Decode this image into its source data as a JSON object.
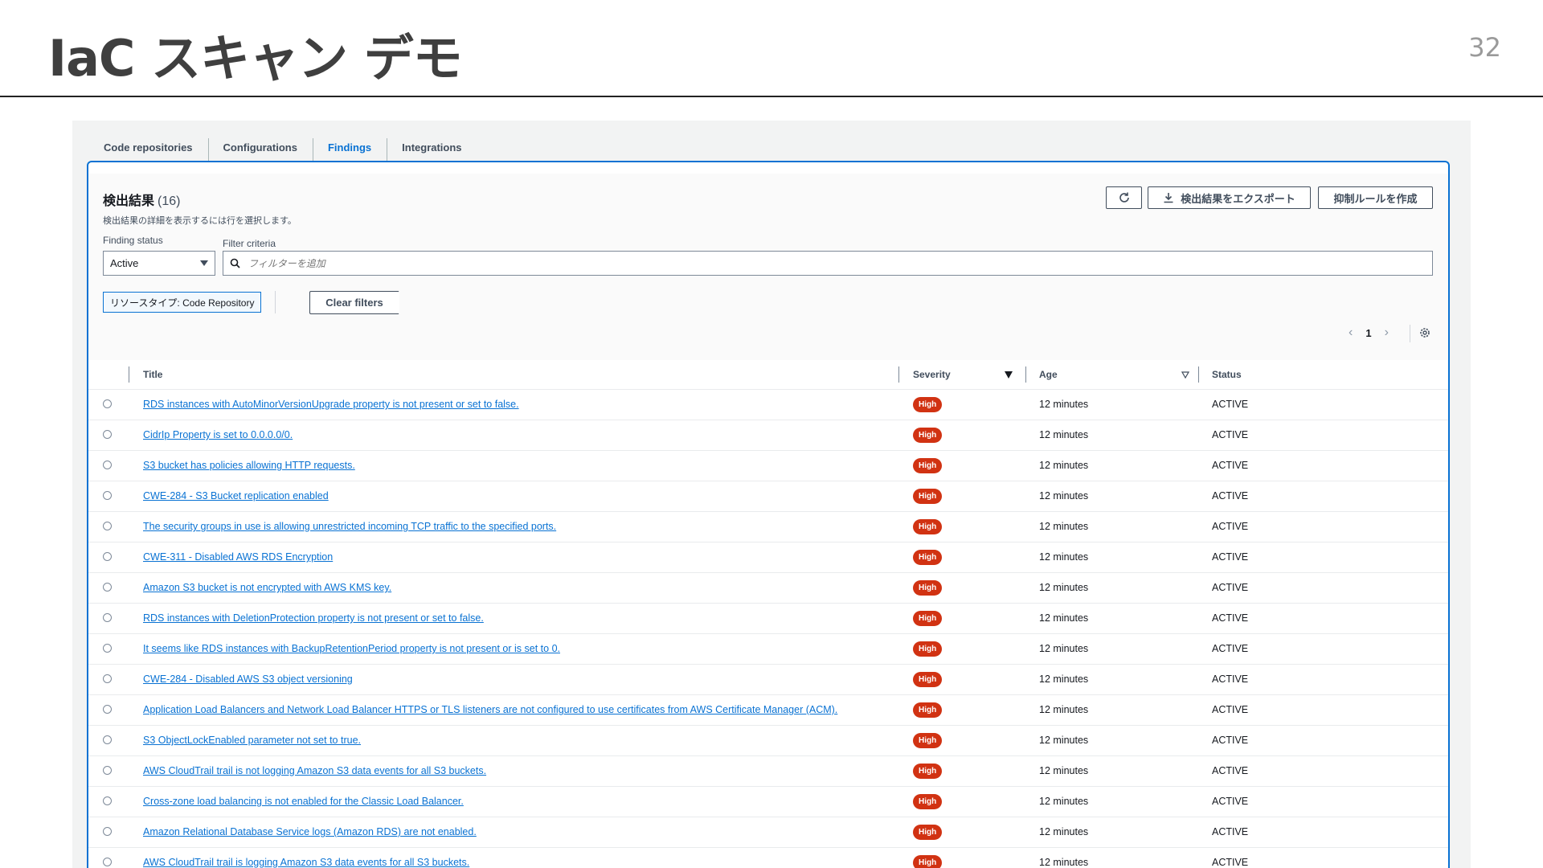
{
  "slide": {
    "title": "IaC スキャン デモ",
    "page_number": "32"
  },
  "tabs": [
    {
      "label": "Code repositories",
      "active": false
    },
    {
      "label": "Configurations",
      "active": false
    },
    {
      "label": "Findings",
      "active": true
    },
    {
      "label": "Integrations",
      "active": false
    }
  ],
  "panel": {
    "title": "検出結果",
    "count": "(16)",
    "description": "検出結果の詳細を表示するには行を選択します。",
    "refresh_icon": "refresh-icon",
    "export_label": "検出結果をエクスポート",
    "export_icon": "download-icon",
    "create_rule_label": "抑制ルールを作成"
  },
  "filters": {
    "status_label": "Finding status",
    "status_value": "Active",
    "criteria_label": "Filter criteria",
    "criteria_placeholder": "フィルターを追加",
    "resource_token": "リソースタイプ: Code Repository",
    "clear_label": "Clear filters"
  },
  "pagination": {
    "current_page": "1",
    "prev_icon": "chevron-left-icon",
    "next_icon": "chevron-right-icon",
    "settings_icon": "gear-icon"
  },
  "table": {
    "columns": {
      "title": "Title",
      "severity": "Severity",
      "age": "Age",
      "status": "Status"
    },
    "rows": [
      {
        "title": "RDS instances with AutoMinorVersionUpgrade property is not present or set to false.",
        "severity": "High",
        "age": "12 minutes",
        "status": "ACTIVE"
      },
      {
        "title": "CidrIp Property is set to 0.0.0.0/0.",
        "severity": "High",
        "age": "12 minutes",
        "status": "ACTIVE"
      },
      {
        "title": "S3 bucket has policies allowing HTTP requests.",
        "severity": "High",
        "age": "12 minutes",
        "status": "ACTIVE"
      },
      {
        "title": "CWE-284 - S3 Bucket replication enabled",
        "severity": "High",
        "age": "12 minutes",
        "status": "ACTIVE"
      },
      {
        "title": "The security groups in use is allowing unrestricted incoming TCP traffic to the specified ports.",
        "severity": "High",
        "age": "12 minutes",
        "status": "ACTIVE"
      },
      {
        "title": "CWE-311 - Disabled AWS RDS Encryption",
        "severity": "High",
        "age": "12 minutes",
        "status": "ACTIVE"
      },
      {
        "title": "Amazon S3 bucket is not encrypted with AWS KMS key.",
        "severity": "High",
        "age": "12 minutes",
        "status": "ACTIVE"
      },
      {
        "title": "RDS instances with DeletionProtection property is not present or set to false.",
        "severity": "High",
        "age": "12 minutes",
        "status": "ACTIVE"
      },
      {
        "title": "It seems like RDS instances with BackupRetentionPeriod property is not present or is set to 0.",
        "severity": "High",
        "age": "12 minutes",
        "status": "ACTIVE"
      },
      {
        "title": "CWE-284 - Disabled AWS S3 object versioning",
        "severity": "High",
        "age": "12 minutes",
        "status": "ACTIVE"
      },
      {
        "title": "Application Load Balancers and Network Load Balancer HTTPS or TLS listeners are not configured to use certificates from AWS Certificate Manager (ACM).",
        "severity": "High",
        "age": "12 minutes",
        "status": "ACTIVE"
      },
      {
        "title": "S3 ObjectLockEnabled parameter not set to true.",
        "severity": "High",
        "age": "12 minutes",
        "status": "ACTIVE"
      },
      {
        "title": "AWS CloudTrail trail is not logging Amazon S3 data events for all S3 buckets.",
        "severity": "High",
        "age": "12 minutes",
        "status": "ACTIVE"
      },
      {
        "title": "Cross-zone load balancing is not enabled for the Classic Load Balancer.",
        "severity": "High",
        "age": "12 minutes",
        "status": "ACTIVE"
      },
      {
        "title": "Amazon Relational Database Service logs (Amazon RDS) are not enabled.",
        "severity": "High",
        "age": "12 minutes",
        "status": "ACTIVE"
      },
      {
        "title": "AWS CloudTrail trail is logging Amazon S3 data events for all S3 buckets.",
        "severity": "High",
        "age": "12 minutes",
        "status": "ACTIVE"
      }
    ]
  },
  "colors": {
    "accent": "#0972d3",
    "severity_high": "#d13212"
  }
}
